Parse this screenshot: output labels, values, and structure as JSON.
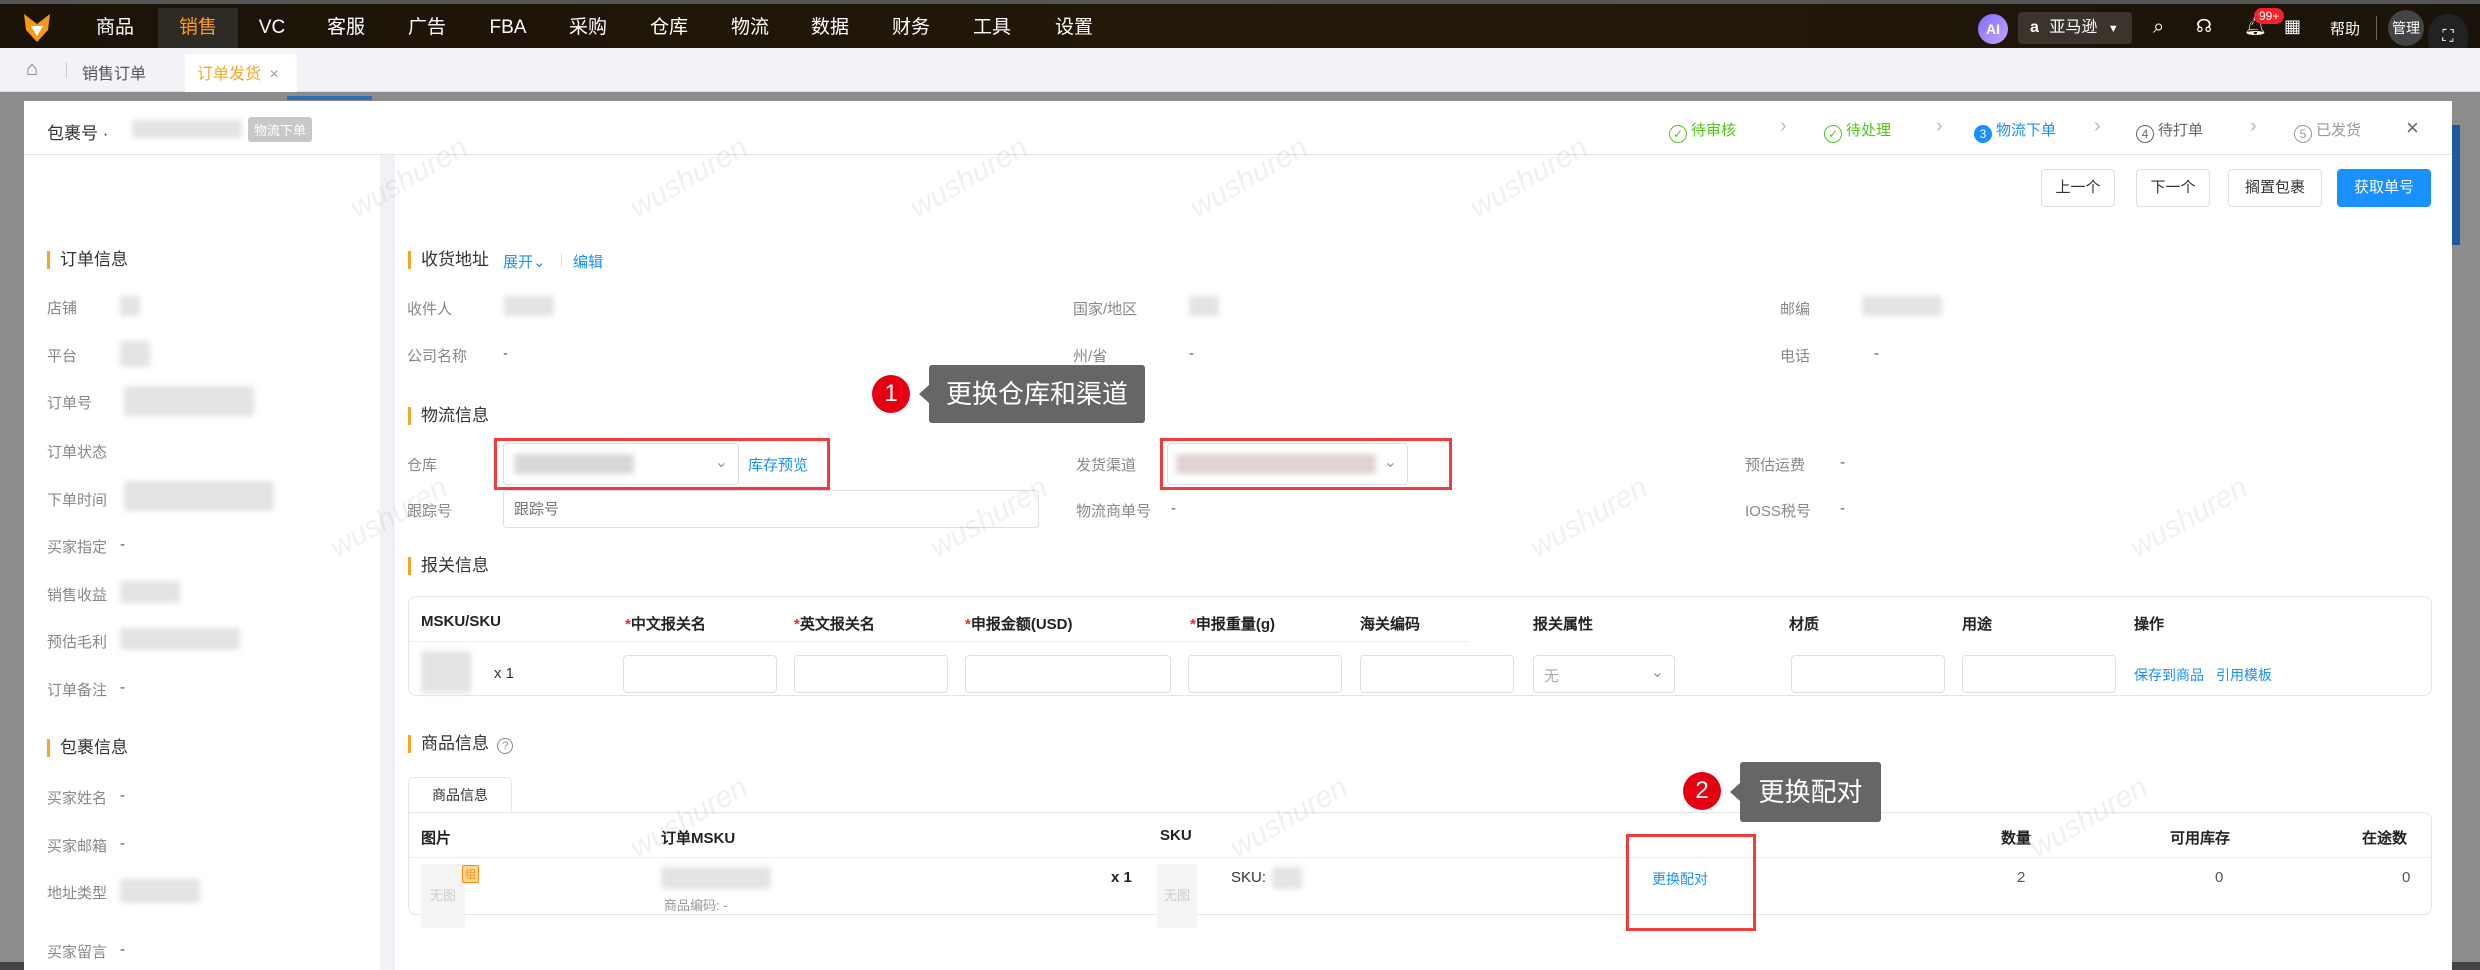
{
  "nav": {
    "items": [
      "商品",
      "销售",
      "VC",
      "客服",
      "广告",
      "FBA",
      "采购",
      "仓库",
      "物流",
      "数据",
      "财务",
      "工具",
      "设置"
    ],
    "active": "销售",
    "ai": "AI",
    "marketplace": "亚马逊",
    "notifications": "99+",
    "help": "帮助",
    "admin": "管理"
  },
  "tabs": {
    "items": [
      "销售订单",
      "订单发货"
    ],
    "close": "×"
  },
  "modal": {
    "package_label": "包裹号",
    "status_badge": "物流下单",
    "steps": [
      {
        "num": "✓",
        "label": "待审核"
      },
      {
        "num": "✓",
        "label": "待处理"
      },
      {
        "num": "3",
        "label": "物流下单"
      },
      {
        "num": "4",
        "label": "待打单"
      },
      {
        "num": "5",
        "label": "已发货"
      }
    ],
    "close": "×",
    "buttons": {
      "prev": "上一个",
      "next": "下一个",
      "hold": "搁置包裹",
      "fetch": "获取单号"
    }
  },
  "order_info": {
    "title": "订单信息",
    "fields": [
      "店铺",
      "平台",
      "订单号",
      "订单状态",
      "下单时间",
      "买家指定",
      "销售收益",
      "预估毛利",
      "订单备注"
    ],
    "buyer_specified": "-",
    "order_note": "-"
  },
  "package_info": {
    "title": "包裹信息",
    "fields": [
      "买家姓名",
      "买家邮箱",
      "地址类型",
      "买家留言"
    ],
    "buyer_name": "-",
    "buyer_email": "-",
    "buyer_message": "-"
  },
  "address": {
    "title": "收货地址",
    "expand": "展开",
    "edit": "编辑",
    "recipient": "收件人",
    "country": "国家/地区",
    "zip": "邮编",
    "company": "公司名称",
    "company_value": "-",
    "state": "州/省",
    "state_value": "-",
    "phone": "电话",
    "phone_value": "-"
  },
  "logistics": {
    "title": "物流信息",
    "warehouse": "仓库",
    "stock_preview": "库存预览",
    "channel": "发货渠道",
    "est_fee": "预估运费",
    "est_fee_value": "-",
    "tracking": "跟踪号",
    "tracking_placeholder": "跟踪号",
    "carrier_no": "物流商单号",
    "carrier_no_value": "-",
    "ioss": "IOSS税号",
    "ioss_value": "-"
  },
  "customs": {
    "title": "报关信息",
    "columns": [
      "MSKU/SKU",
      "中文报关名",
      "英文报关名",
      "申报金额(USD)",
      "申报重量(g)",
      "海关编码",
      "报关属性",
      "材质",
      "用途",
      "操作"
    ],
    "qty": "x 1",
    "attr_value": "无",
    "save_to_product": "保存到商品",
    "use_template": "引用模板"
  },
  "products": {
    "title": "商品信息",
    "tab": "商品信息",
    "columns": [
      "图片",
      "订单MSKU",
      "SKU",
      "数量",
      "可用库存",
      "在途数"
    ],
    "row": {
      "no_image": "无图",
      "combo": "组",
      "product_code": "商品编码: -",
      "qty_mult": "x 1",
      "sku_label": "SKU:",
      "rematch": "更换配对",
      "quantity": "2",
      "available": "0",
      "in_transit": "0"
    }
  },
  "annotations": [
    {
      "num": "1",
      "text": "更换仓库和渠道"
    },
    {
      "num": "2",
      "text": "更换配对"
    }
  ],
  "watermark": "wushuren"
}
